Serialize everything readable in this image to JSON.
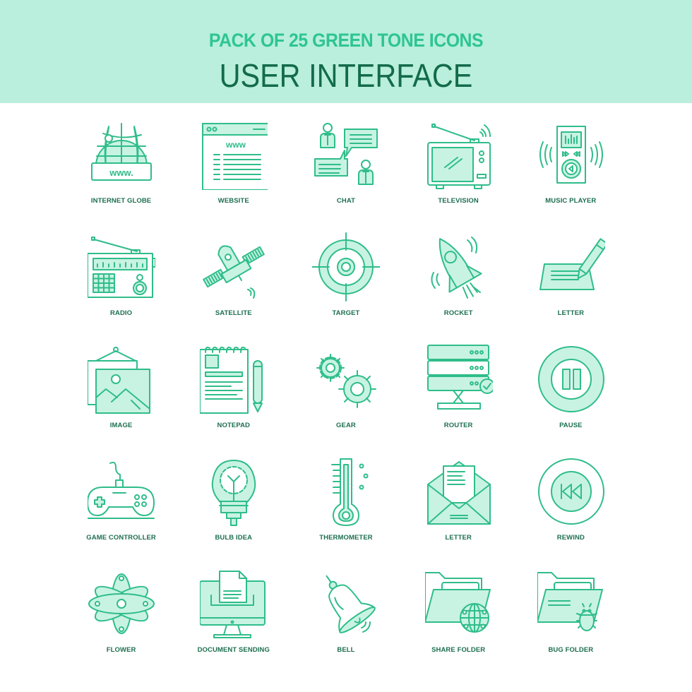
{
  "header": {
    "subtitle": "PACK OF 25 GREEN TONE ICONS",
    "title": "USER INTERFACE"
  },
  "colors": {
    "banner": "#b9efdc",
    "subtitle": "#2ec592",
    "title": "#136b4b",
    "stroke": "#2fbd8a",
    "fill": "#c8f3e2",
    "label": "#1d6f4f"
  },
  "icons": [
    {
      "label": "INTERNET GLOBE",
      "icon": "internet-globe-icon",
      "text": "www."
    },
    {
      "label": "WEBSITE",
      "icon": "website-icon",
      "text": "www"
    },
    {
      "label": "CHAT",
      "icon": "chat-icon"
    },
    {
      "label": "TELEVISION",
      "icon": "television-icon"
    },
    {
      "label": "MUSIC PLAYER",
      "icon": "music-player-icon"
    },
    {
      "label": "RADIO",
      "icon": "radio-icon"
    },
    {
      "label": "SATELLITE",
      "icon": "satellite-icon"
    },
    {
      "label": "TARGET",
      "icon": "target-icon"
    },
    {
      "label": "ROCKET",
      "icon": "rocket-icon"
    },
    {
      "label": "LETTER",
      "icon": "letter-pen-icon"
    },
    {
      "label": "IMAGE",
      "icon": "image-icon"
    },
    {
      "label": "NOTEPAD",
      "icon": "notepad-icon"
    },
    {
      "label": "GEAR",
      "icon": "gear-icon"
    },
    {
      "label": "ROUTER",
      "icon": "router-icon"
    },
    {
      "label": "PAUSE",
      "icon": "pause-icon"
    },
    {
      "label": "GAME CONTROLLER",
      "icon": "game-controller-icon"
    },
    {
      "label": "BULB IDEA",
      "icon": "bulb-idea-icon"
    },
    {
      "label": "THERMOMETER",
      "icon": "thermometer-icon"
    },
    {
      "label": "LETTER",
      "icon": "envelope-letter-icon"
    },
    {
      "label": "REWIND",
      "icon": "rewind-icon"
    },
    {
      "label": "FLOWER",
      "icon": "flower-icon"
    },
    {
      "label": "DOCUMENT SENDING",
      "icon": "document-sending-icon"
    },
    {
      "label": "BELL",
      "icon": "bell-icon"
    },
    {
      "label": "SHARE FOLDER",
      "icon": "share-folder-icon"
    },
    {
      "label": "BUG FOLDER",
      "icon": "bug-folder-icon"
    }
  ]
}
